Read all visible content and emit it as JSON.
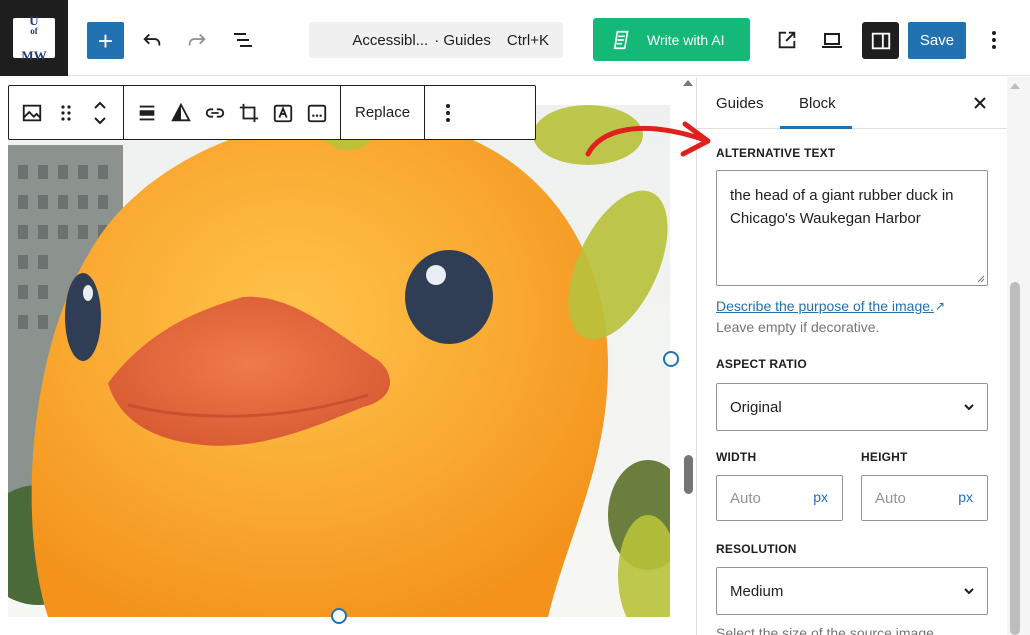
{
  "logo": {
    "line1": "U",
    "line1_small": "of",
    "line2": "MW"
  },
  "command_bar": {
    "title": "Accessibl...",
    "section": "· Guides",
    "shortcut": "Ctrl+K"
  },
  "ai_button": {
    "label": "Write with AI"
  },
  "save_button": {
    "label": "Save"
  },
  "block_toolbar": {
    "replace_label": "Replace"
  },
  "image": {
    "subject": "giant rubber duck"
  },
  "sidebar": {
    "tabs": [
      {
        "label": "Guides"
      },
      {
        "label": "Block"
      }
    ],
    "active_tab": "Block",
    "alt_text": {
      "label": "ALTERNATIVE TEXT",
      "value": "the head of a giant rubber duck in Chicago's Waukegan Harbor",
      "help_link": "Describe the purpose of the image.",
      "help_text": "Leave empty if decorative."
    },
    "aspect_ratio": {
      "label": "ASPECT RATIO",
      "value": "Original"
    },
    "width": {
      "label": "WIDTH",
      "placeholder": "Auto",
      "unit": "px"
    },
    "height": {
      "label": "HEIGHT",
      "placeholder": "Auto",
      "unit": "px"
    },
    "resolution": {
      "label": "RESOLUTION",
      "value": "Medium",
      "help_text": "Select the size of the source image."
    }
  },
  "colors": {
    "accent": "#2271b1",
    "ai_green": "#14b877",
    "annotation_red": "#e0201c"
  }
}
